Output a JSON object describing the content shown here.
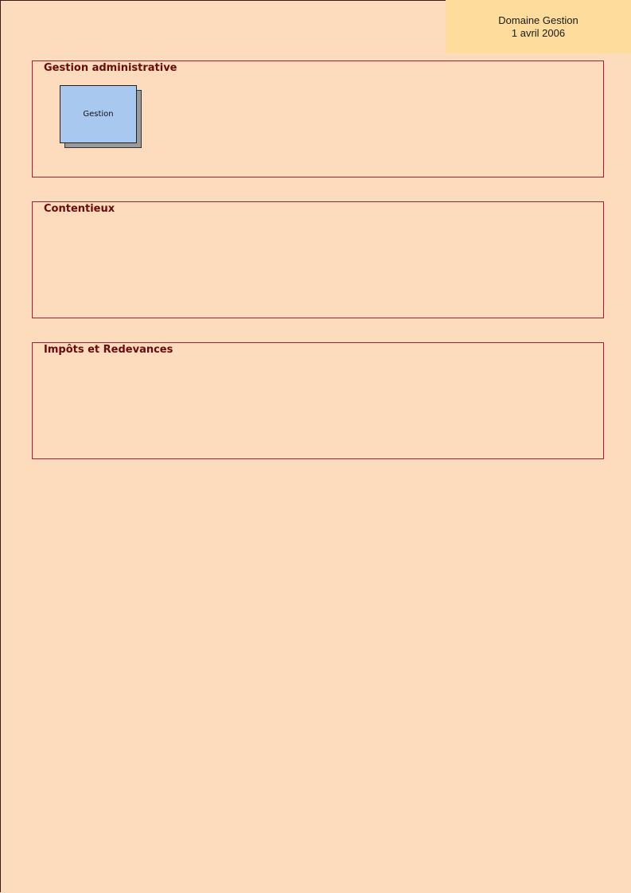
{
  "header": {
    "title": "Domaine Gestion",
    "date": "1 avril 2006"
  },
  "sections": [
    {
      "title": "Gestion administrative",
      "nodes": [
        {
          "label": "Gestion"
        }
      ]
    },
    {
      "title": "Contentieux",
      "nodes": []
    },
    {
      "title": "Impôts et Redevances",
      "nodes": []
    }
  ],
  "colors": {
    "page_background": "#fcdcbc",
    "header_background": "#fddc9c",
    "section_border": "#a0203a",
    "section_title": "#6a0a0a",
    "node_fill": "#a9c8f0",
    "node_shadow": "#9a9a9a"
  }
}
